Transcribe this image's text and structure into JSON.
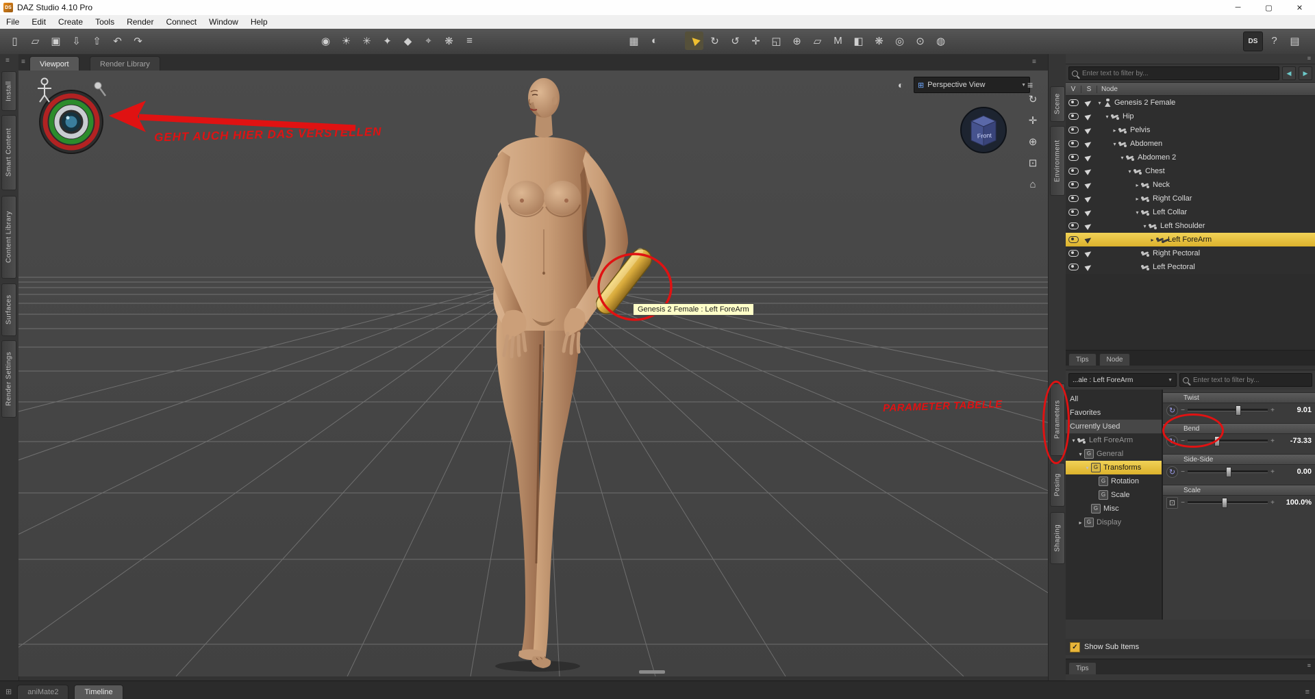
{
  "window": {
    "title": "DAZ Studio 4.10 Pro",
    "logo": "DS"
  },
  "menu": {
    "items": [
      "File",
      "Edit",
      "Create",
      "Tools",
      "Render",
      "Connect",
      "Window",
      "Help"
    ]
  },
  "left_dock_tabs": [
    "Install",
    "Smart Content",
    "Content Library",
    "Surfaces",
    "Render Settings"
  ],
  "right_dock_tabs": [
    "Scene",
    "Environment",
    "Parameters",
    "Posing",
    "Shaping"
  ],
  "viewport": {
    "tabs": [
      "Viewport",
      "Render Library"
    ],
    "view_selector": "Perspective View",
    "cube_gizmo_label": "Front",
    "tooltip": "Genesis 2 Female : Left ForeArm",
    "annotations": {
      "arrow_text": "GEHT AUCH HIER DAS VERSTELLEN",
      "param_text": "PARAMETER TABELLE"
    },
    "colors": {
      "annotation_red": "#e01212",
      "selection_gold": "#d9ab3c",
      "tooltip_bg": "#ffffc8"
    }
  },
  "scene_panel": {
    "filter_placeholder": "Enter text to filter by...",
    "columns": {
      "v": "V",
      "s": "S",
      "node": "Node"
    },
    "tree": [
      {
        "label": "Genesis 2 Female",
        "depth": 0,
        "state": "expanded"
      },
      {
        "label": "Hip",
        "depth": 1,
        "state": "expanded"
      },
      {
        "label": "Pelvis",
        "depth": 2,
        "state": "collapsed"
      },
      {
        "label": "Abdomen",
        "depth": 2,
        "state": "expanded"
      },
      {
        "label": "Abdomen 2",
        "depth": 3,
        "state": "expanded"
      },
      {
        "label": "Chest",
        "depth": 4,
        "state": "expanded"
      },
      {
        "label": "Neck",
        "depth": 5,
        "state": "collapsed"
      },
      {
        "label": "Right Collar",
        "depth": 5,
        "state": "collapsed"
      },
      {
        "label": "Left Collar",
        "depth": 5,
        "state": "expanded"
      },
      {
        "label": "Left Shoulder",
        "depth": 6,
        "state": "expanded"
      },
      {
        "label": "Left ForeArm",
        "depth": 7,
        "state": "collapsed",
        "selected": true
      },
      {
        "label": "Right Pectoral",
        "depth": 5,
        "state": "leaf"
      },
      {
        "label": "Left Pectoral",
        "depth": 5,
        "state": "leaf"
      }
    ],
    "tabs": [
      "Tips",
      "Node"
    ]
  },
  "parameters_panel": {
    "selector_label": "...ale : Left ForeArm",
    "filter_placeholder": "Enter text to filter by...",
    "list": [
      {
        "label": "All"
      },
      {
        "label": "Favorites"
      },
      {
        "label": "Currently Used",
        "selected_soft": true
      },
      {
        "label": "Left ForeArm",
        "depth": 0,
        "state": "expanded",
        "dim": true
      },
      {
        "label": "General",
        "depth": 1,
        "state": "expanded",
        "dim": true
      },
      {
        "label": "Transforms",
        "depth": 2,
        "state": "expanded",
        "selected": true
      },
      {
        "label": "Rotation",
        "depth": 3,
        "state": "leaf"
      },
      {
        "label": "Scale",
        "depth": 3,
        "state": "leaf"
      },
      {
        "label": "Misc",
        "depth": 2,
        "state": "leaf"
      },
      {
        "label": "Display",
        "depth": 1,
        "state": "collapsed",
        "dim": true
      }
    ],
    "sliders": [
      {
        "name": "Twist",
        "value": "9.01"
      },
      {
        "name": "Bend",
        "value": "-73.33"
      },
      {
        "name": "Side-Side",
        "value": "0.00"
      },
      {
        "name": "Scale",
        "value": "100.0%"
      }
    ],
    "show_sub_items": "Show Sub Items",
    "tips_tab": "Tips"
  },
  "bottom_bar": {
    "tabs": [
      "aniMate2",
      "Timeline"
    ]
  },
  "icons": {
    "app-minimize": "─",
    "app-maximize": "▢",
    "app-close": "✕",
    "panel-menu": "≡",
    "panel-grid": "⊞",
    "tb-new": "▯",
    "tb-open": "▱",
    "tb-save": "▣",
    "tb-import": "⇩",
    "tb-export": "⇧",
    "tb-undo": "↶",
    "tb-redo": "↷",
    "tb-new-camera": "◉",
    "tb-distant-light": "☀",
    "tb-point-light": "✳",
    "tb-spotlight": "✦",
    "tb-primitive": "◆",
    "tb-null": "⌖",
    "tb-dform": "❋",
    "tb-align": "≡",
    "tb-dock": "▦",
    "tb-aux": "◐",
    "tb-pointer": "▶",
    "tb-rotate": "↻",
    "tb-orbit": "↺",
    "tb-translate": "✛",
    "tb-scale": "◱",
    "tb-universal": "⊕",
    "tb-shear": "▱",
    "tb-animate": "M",
    "tb-surface": "◧",
    "tb-comb": "❋",
    "tb-camera": "◎",
    "tb-photo": "⊙",
    "tb-render": "◍",
    "tb-ds": "DS",
    "tb-help": "?",
    "tb-more": "▤",
    "vp-sphere": "◐",
    "vp-list": "≡",
    "vp-grid": "⊞",
    "nav-orbit": "↻",
    "nav-pan": "✛",
    "nav-zoom": "⊕",
    "nav-frame": "⊡",
    "nav-home": "⌂",
    "filter-prev": "◀",
    "filter-next": "▶",
    "dropdown-arrow": "▼",
    "slider-minus": "−",
    "slider-plus": "+",
    "slider-rotate": "↻",
    "slider-scale": "⊡",
    "check": "✓"
  }
}
